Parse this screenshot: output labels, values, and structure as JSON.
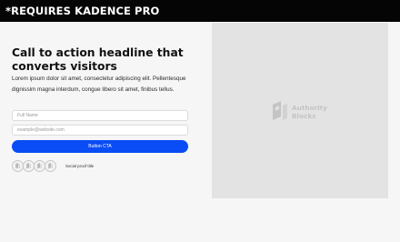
{
  "banner": {
    "text": "*REQUIRES KADENCE PRO"
  },
  "hero": {
    "headline": "Call to action headline that converts visitors",
    "body": "Lorem ipsum dolor sit amet, consectetur adipiscing elit. Pellentesque dignissim magna interdum, congue libero sit amet, finibus tellus."
  },
  "form": {
    "name_placeholder": "Full Name",
    "email_placeholder": "example@website.com",
    "cta_label": "Button CTA"
  },
  "social_proof": {
    "title": "Social proof title",
    "avatar_icon": "authority-blocks-logo-icon",
    "avatar_count": 4
  },
  "image_placeholder": {
    "logo_line1": "Authority",
    "logo_line2": "Blocks",
    "logo_icon": "authority-blocks-logo-icon"
  },
  "colors": {
    "banner_bg": "#050505",
    "page_bg": "#f6f6f6",
    "cta_bg": "#0a4cf5",
    "image_bg": "#e3e3e3",
    "logo_color": "#c4c4c4"
  }
}
